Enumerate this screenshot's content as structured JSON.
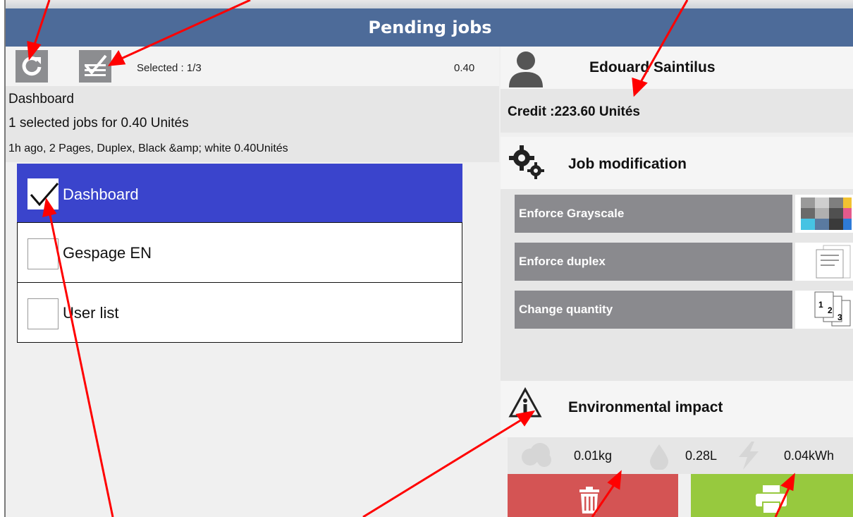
{
  "header": {
    "title": "Pending jobs"
  },
  "toolbar": {
    "refresh_icon": "refresh-icon",
    "select_all_icon": "select-all-checklist-icon",
    "selected_label": "Selected : 1/3",
    "selected_amount": "0.40"
  },
  "summary": {
    "title": "Dashboard",
    "selection_text": "1 selected jobs for 0.40 Unités",
    "details": "1h ago,  2 Pages,  Duplex,  Black &amp; white  0.40Unités"
  },
  "jobs": [
    {
      "label": "Dashboard",
      "checked": true
    },
    {
      "label": "Gespage EN",
      "checked": false
    },
    {
      "label": "User list",
      "checked": false
    }
  ],
  "user": {
    "name": "Edouard Saintilus",
    "credit": "Credit :223.60 Unités"
  },
  "job_modification": {
    "title": "Job modification",
    "buttons": [
      {
        "label": "Enforce Grayscale",
        "icon": "grayscale-swatch-icon"
      },
      {
        "label": "Enforce duplex",
        "icon": "duplex-pages-icon"
      },
      {
        "label": "Change quantity",
        "icon": "copies-stack-icon"
      }
    ]
  },
  "environment": {
    "title": "Environmental impact",
    "co2": "0.01kg",
    "water": "0.28L",
    "energy": "0.04kWh"
  },
  "actions": {
    "delete_icon": "trash-icon",
    "print_icon": "printer-icon"
  },
  "colors": {
    "header": "#4d6b99",
    "selected_row": "#3a44cc",
    "delete": "#d45454",
    "print": "#97c93e",
    "annotation_arrow": "#ff0000"
  }
}
